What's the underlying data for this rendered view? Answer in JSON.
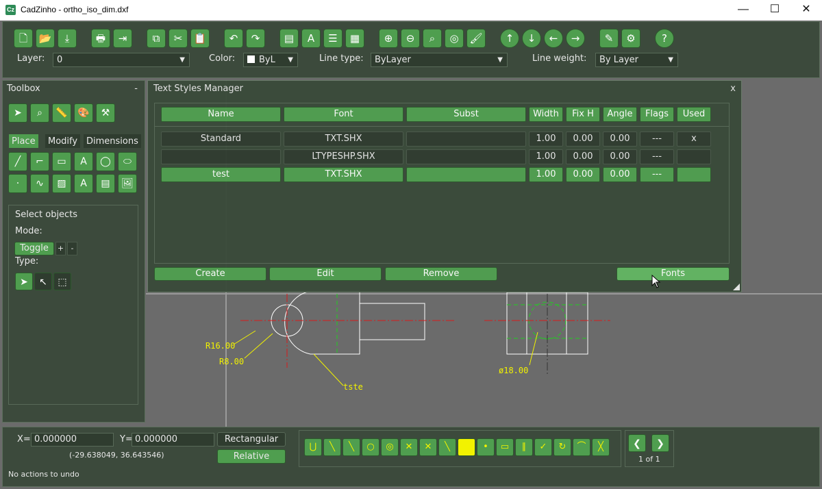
{
  "window": {
    "title": "CadZinho - ortho_iso_dim.dxf",
    "app_icon": "Cz"
  },
  "titlebar_buttons": {
    "minimize": "—",
    "maximize": "☐",
    "close": "✕"
  },
  "main_toolbar": {
    "icons": [
      "new-file-icon",
      "open-folder-icon",
      "save-icon",
      "print-icon",
      "export-icon",
      "copy-icon",
      "cut-icon",
      "paste-icon",
      "undo-icon",
      "redo-icon",
      "layers-icon",
      "text-icon",
      "line-type-icon",
      "blocks-icon",
      "zoom-in-icon",
      "zoom-out-icon",
      "zoom-window-icon",
      "zoom-extents-icon",
      "brush-icon",
      "arrow-up-icon",
      "arrow-down-icon",
      "arrow-left-icon",
      "arrow-right-icon",
      "script-icon",
      "gear-icon",
      "help-icon"
    ],
    "glyphs": [
      "🗋",
      "📂",
      "⤓",
      "🖶",
      "⇥",
      "⧉",
      "✂",
      "📋",
      "↶",
      "↷",
      "▤",
      "A",
      "☰",
      "▦",
      "⊕",
      "⊖",
      "⌕",
      "◎",
      "🖌",
      "↑",
      "↓",
      "←",
      "→",
      "✎",
      "⚙",
      "?"
    ]
  },
  "properties": {
    "layer_label": "Layer:",
    "layer_value": "0",
    "color_label": "Color:",
    "color_value": "ByL",
    "linetype_label": "Line type:",
    "linetype_value": "ByLayer",
    "lineweight_label": "Line weight:",
    "lineweight_value": "By Layer"
  },
  "toolbox": {
    "title": "Toolbox",
    "collapse": "-",
    "tabs": [
      "Place",
      "Modify",
      "Dimensions"
    ],
    "select_title": "Select objects",
    "mode_label": "Mode:",
    "toggle_label": "Toggle",
    "plus_label": "+",
    "minus_label": "-",
    "type_label": "Type:"
  },
  "text_styles_dialog": {
    "title": "Text Styles Manager",
    "close": "x",
    "headers": [
      "Name",
      "Font",
      "Subst",
      "Width",
      "Fix H",
      "Angle",
      "Flags",
      "Used"
    ],
    "rows": [
      {
        "name": "Standard",
        "font": "TXT.SHX",
        "subst": "",
        "width": "1.00",
        "fixh": "0.00",
        "angle": "0.00",
        "flags": "---",
        "used": "x"
      },
      {
        "name": "",
        "font": "LTYPESHP.SHX",
        "subst": "",
        "width": "1.00",
        "fixh": "0.00",
        "angle": "0.00",
        "flags": "---",
        "used": ""
      },
      {
        "name": "test",
        "font": "TXT.SHX",
        "subst": "",
        "width": "1.00",
        "fixh": "0.00",
        "angle": "0.00",
        "flags": "---",
        "used": ""
      }
    ],
    "buttons": {
      "create": "Create",
      "edit": "Edit",
      "remove": "Remove",
      "fonts": "Fonts"
    }
  },
  "drawing": {
    "dim_r16": "R16.00",
    "dim_r8": "R8.00",
    "label_tste": "tste",
    "dim_dia": "ø18.00"
  },
  "status": {
    "x_label": "X=",
    "x_value": "0.000000",
    "y_label": "Y=",
    "y_value": "0.000000",
    "coord_mode": "Rectangular",
    "relative": "Relative",
    "cursor_pos": "(-29.638049,  36.643546)",
    "undo_msg": "No actions to undo",
    "page": "1 of 1"
  },
  "colors": {
    "accent": "#4f9e4f",
    "panel": "#3c4a3c",
    "canvas": "#6b6b6b",
    "dim": "#f2f200",
    "center": "#d81b1b",
    "hidden": "#22cc22"
  }
}
